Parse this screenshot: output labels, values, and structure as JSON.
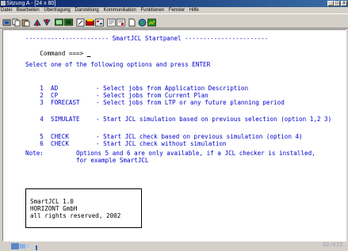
{
  "window": {
    "title": "Sitzung A - [24 x 80]",
    "controls": [
      "_",
      "□",
      "x"
    ]
  },
  "menu": [
    "Datei",
    "Bearbeiten",
    "Übertragung",
    "Darstellung",
    "Kommunikation",
    "Funktionen",
    "Fenster",
    "Hilfe"
  ],
  "terminal": {
    "banner": "----------------------- SmartJCL Startpanel -----------------------",
    "command_label": "Command ===>",
    "command_value": "_",
    "prompt": "Select one of the following options and press ENTER",
    "options": [
      {
        "num": "1",
        "code": "AD",
        "desc": "- Select jobs from Application Description"
      },
      {
        "num": "2",
        "code": "CP",
        "desc": "- Select jobs from Current Plan"
      },
      {
        "num": "3",
        "code": "FORECAST",
        "desc": "- Select jobs from LTP or any future planning period"
      },
      {
        "num": "4",
        "code": "SIMULATE",
        "desc": "- Start JCL simulation based on previous selection (option 1,2 3)"
      },
      {
        "num": "5",
        "code": "CHECK",
        "desc": "- Start JCL check based on previous simulation (option 4)"
      },
      {
        "num": "6",
        "code": "CHECK",
        "desc": "- Start JCL check without simulation"
      }
    ],
    "note_label": "Note:",
    "note_line1": "Options 5 and 6 are only available, if a JCL checker is installed,",
    "note_line2": "for example SmartJCL",
    "info": [
      "SmartJCL 1.0",
      "HORIZONT GmbH",
      "all rights reserved, 2002"
    ],
    "page_indicator": "02/015"
  },
  "colors": {
    "terminal_text": "#0000cc",
    "terminal_bg": "#ffffff",
    "window_bg": "#d4d0c8",
    "titlebar": "#0a246a"
  }
}
